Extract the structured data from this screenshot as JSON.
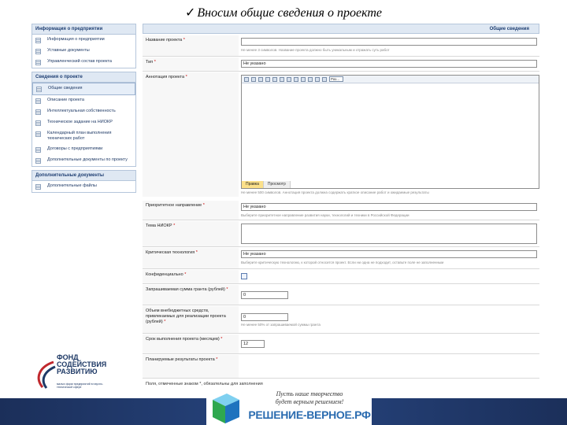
{
  "slide": {
    "title": "Вносим общие сведения о проекте",
    "check_mark": "✓"
  },
  "sidebar": {
    "sections": [
      {
        "title": "Информация о предприятии",
        "items": [
          "Информация о предприятии",
          "Уставные документы",
          "Управленческий состав проекта"
        ]
      },
      {
        "title": "Сведения о проекте",
        "items": [
          "Общие сведения",
          "Описание проекта",
          "Интеллектуальная собственность",
          "Техническое задание на НИОКР",
          "Календарный план выполнения технических работ",
          "Договоры с предприятиями",
          "Дополнительные документы по проекту"
        ]
      },
      {
        "title": "Дополнительные документы",
        "items": [
          "Дополнительные файлы"
        ]
      }
    ]
  },
  "form": {
    "header": "Общие сведения",
    "fields": {
      "name_label": "Название проекта",
      "name_hint": "Не менее 3 символов. Название проекта должно быть уникальным и отражать суть работ",
      "type_label": "Тип",
      "type_value": "Не указано",
      "annotation_label": "Аннотация проекта",
      "annotation_hint": "Не менее 500 символов. Аннотация проекта должна содержать краткое описание работ и ожидаемые результаты",
      "priority_label": "Приоритетное направление",
      "priority_value": "Не указано",
      "priority_hint": "Выберите приоритетное направление развития науки, технологий и техники в Российской Федерации",
      "theme_label": "Тема НИОКР",
      "critical_label": "Критическая технология",
      "critical_value": "Не указано",
      "critical_hint": "Выберите критическую технологию, к которой относится проект. Если ни одна не подходит, оставьте поле не заполненным",
      "confidential_label": "Конфиденциально",
      "budget_label": "Запрашиваемая сумма гранта (рублей)",
      "budget_value": "0",
      "own_funds_label": "Объем внебюджетных средств, привлекаемых для реализации проекта (рублей)",
      "own_funds_value": "0",
      "own_funds_hint": "Не менее 50% от запрашиваемой суммы гранта",
      "duration_label": "Срок выполнения проекта (месяцев)",
      "duration_value": "12",
      "results_label": "Планируемые результаты проекта",
      "bottom_note": "Поля, отмеченные знаком *, обязательны для заполнения"
    },
    "editor": {
      "format_select": "Раз...",
      "tab_edit": "Правка",
      "tab_preview": "Просмотр"
    }
  },
  "logo": {
    "lines": [
      "ФОНД",
      "СОДЕЙСТВИЯ",
      "РАЗВИТИЮ"
    ],
    "subtitle": "малых форм предприятий в научно-технической сфере"
  },
  "footer": {
    "slogan_line1": "Пусть наше творчество",
    "slogan_line2": "будет верным решением!",
    "site": "РЕШЕНИЕ-ВЕРНОЕ.РФ"
  },
  "colors": {
    "sidebar_head": "#dfe8f3",
    "footer_band": "#1b2f5a",
    "site_text": "#2b6cb0"
  }
}
